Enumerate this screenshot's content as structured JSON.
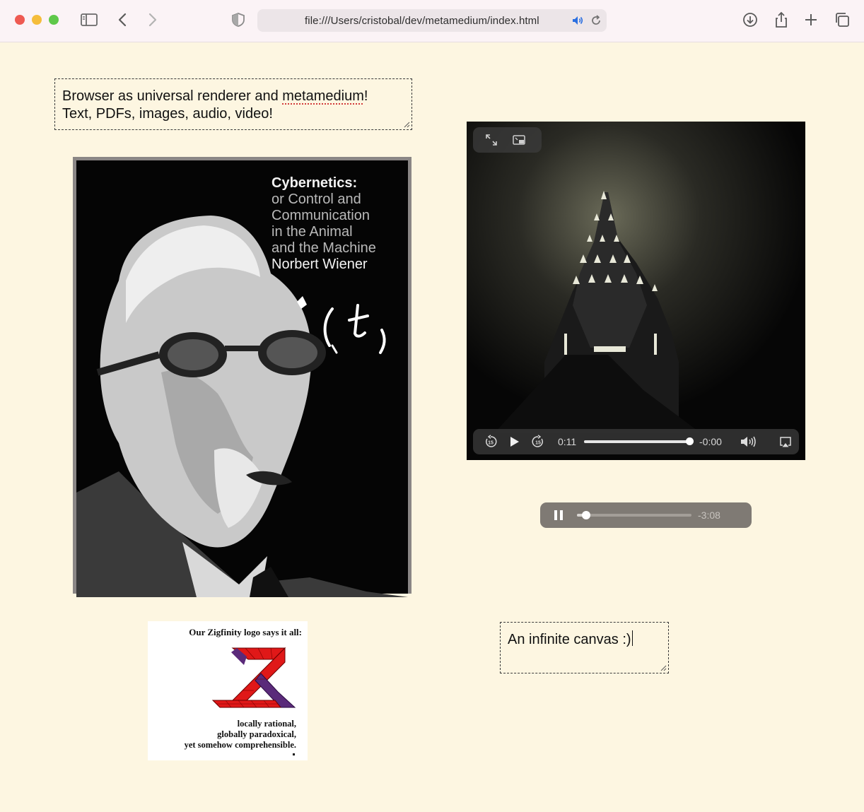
{
  "browser": {
    "url": "file:///Users/cristobal/dev/metamedium/index.html"
  },
  "canvas": {
    "note_intro": {
      "line1_prefix": "Browser as universal renderer and ",
      "line1_misspelled": "metamedium",
      "line1_suffix": "!",
      "line2": "Text, PDFs, images, audio, video!"
    },
    "note_infinite": "An infinite canvas :)",
    "book_cover": {
      "title": "Cybernetics:",
      "subtitle_lines": [
        "or Control and",
        "Communication",
        "in the Animal",
        "and the Machine"
      ],
      "author": "Norbert Wiener"
    },
    "video_player": {
      "elapsed": "0:11",
      "remaining": "-0:00",
      "progress": 0.98
    },
    "audio_player": {
      "remaining": "-3:08",
      "progress": 0.08
    },
    "zigfinity": {
      "heading": "Our Zigfinity logo says it all:",
      "caption_lines": [
        "locally rational,",
        "globally paradoxical,",
        "yet somehow comprehensible."
      ]
    }
  },
  "colors": {
    "canvas_bg": "#fdf6e1",
    "accent_audio_icon": "#2b6fe0",
    "logo_red": "#e01818",
    "logo_purple": "#5a2a7a"
  },
  "icons": [
    "sidebar-icon",
    "back-icon",
    "forward-icon",
    "shield-icon",
    "audio-playing-icon",
    "reload-icon",
    "download-icon",
    "share-icon",
    "new-tab-icon",
    "tabs-overview-icon",
    "fullscreen-icon",
    "picture-in-picture-icon",
    "skip-back-15-icon",
    "play-icon",
    "skip-forward-15-icon",
    "volume-icon",
    "airplay-icon",
    "pause-icon"
  ]
}
